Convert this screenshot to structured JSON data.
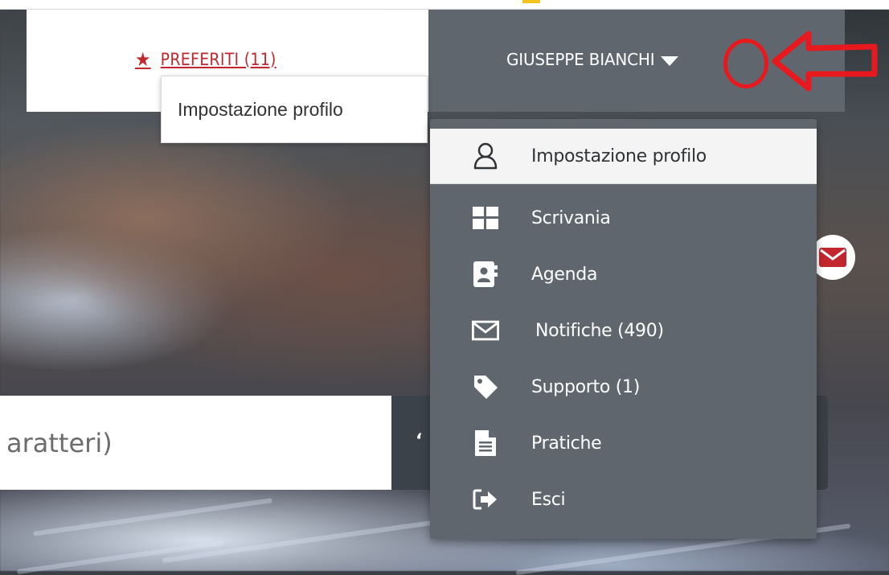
{
  "header": {
    "favorites_label": "PREFERITI (11)",
    "user_name": "GIUSEPPE BIANCHI",
    "accent_color": "#c1272d"
  },
  "tooltip": {
    "text": "Impostazione profilo"
  },
  "search": {
    "value": "aratteri)"
  },
  "user_menu": {
    "items": [
      {
        "label": "Impostazione profilo",
        "icon": "user-icon"
      },
      {
        "label": "Scrivania",
        "icon": "grid-icon"
      },
      {
        "label": "Agenda",
        "icon": "contact-book-icon"
      },
      {
        "label": "Notifiche (490)",
        "icon": "envelope-icon"
      },
      {
        "label": "Supporto (1)",
        "icon": "tag-icon"
      },
      {
        "label": "Pratiche",
        "icon": "document-icon"
      },
      {
        "label": "Esci",
        "icon": "sign-out-icon"
      }
    ]
  },
  "annotation": {
    "color": "#e8191e"
  }
}
